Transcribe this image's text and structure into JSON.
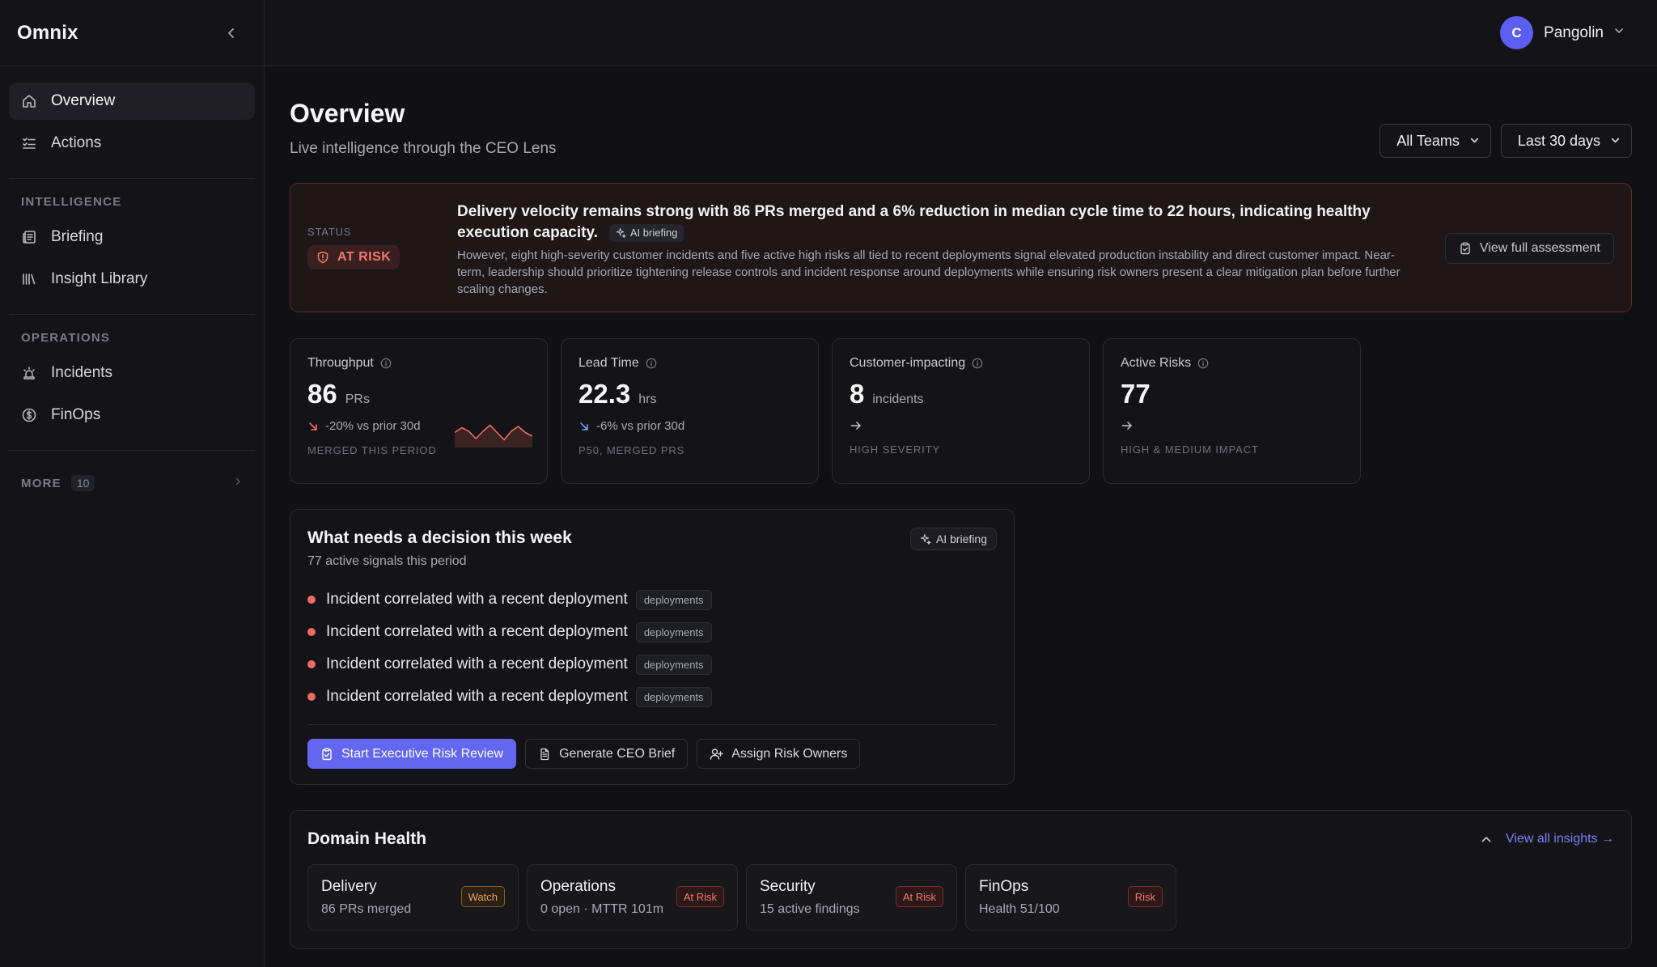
{
  "app": {
    "brand": "Omnix"
  },
  "sidebar": {
    "primary": [
      {
        "label": "Overview",
        "icon": "home-icon",
        "active": true
      },
      {
        "label": "Actions",
        "icon": "list-check-icon",
        "active": false
      }
    ],
    "intelligence_heading": "INTELLIGENCE",
    "intelligence": [
      {
        "label": "Briefing",
        "icon": "newspaper-icon"
      },
      {
        "label": "Insight Library",
        "icon": "library-icon"
      }
    ],
    "operations_heading": "OPERATIONS",
    "operations": [
      {
        "label": "Incidents",
        "icon": "siren-icon"
      },
      {
        "label": "FinOps",
        "icon": "dollar-circle-icon"
      }
    ],
    "more": {
      "label": "MORE",
      "count": "10"
    }
  },
  "user": {
    "initial": "C",
    "name": "Pangolin"
  },
  "header": {
    "title": "Overview",
    "subtitle": "Live intelligence through the CEO Lens",
    "team_filter": "All Teams",
    "range_filter": "Last 30 days"
  },
  "banner": {
    "status_label": "STATUS",
    "status": "AT RISK",
    "headline": "Delivery velocity remains strong with 86 PRs merged and a 6% reduction in median cycle time to 22 hours, indicating healthy execution capacity.",
    "chip": "AI briefing",
    "body": "However, eight high-severity customer incidents and five active high risks all tied to recent deployments signal elevated production instability and direct customer impact. Near-term, leadership should prioritize tightening release controls and incident response around deployments while ensuring risk owners present a clear mitigation plan before further scaling changes.",
    "view_button": "View full assessment"
  },
  "kpis": [
    {
      "label": "Throughput",
      "value": "86",
      "unit": "PRs",
      "delta": "-20% vs prior 30d",
      "foot": "MERGED THIS PERIOD",
      "trend": "down-red"
    },
    {
      "label": "Lead Time",
      "value": "22.3",
      "unit": "hrs",
      "delta": "-6% vs prior 30d",
      "foot": "P50, MERGED PRS",
      "trend": "down-blue"
    },
    {
      "label": "Customer-impacting",
      "value": "8",
      "unit": "incidents",
      "foot": "HIGH SEVERITY"
    },
    {
      "label": "Active Risks",
      "value": "77",
      "unit": "",
      "foot": "HIGH & MEDIUM IMPACT"
    }
  ],
  "decision": {
    "title": "What needs a decision this week",
    "subtitle": "77 active signals this period",
    "chip": "AI briefing",
    "signals": [
      {
        "text": "Incident correlated with a recent deployment",
        "tag": "deployments"
      },
      {
        "text": "Incident correlated with a recent deployment",
        "tag": "deployments"
      },
      {
        "text": "Incident correlated with a recent deployment",
        "tag": "deployments"
      },
      {
        "text": "Incident correlated with a recent deployment",
        "tag": "deployments"
      }
    ],
    "actions": {
      "primary": "Start Executive Risk Review",
      "brief": "Generate CEO Brief",
      "owners": "Assign Risk Owners"
    }
  },
  "domain": {
    "title": "Domain Health",
    "link": "View all insights →",
    "cards": [
      {
        "name": "Delivery",
        "sub": "86 PRs merged",
        "badge": "Watch",
        "tone": "watch"
      },
      {
        "name": "Operations",
        "sub": "0 open · MTTR 101m",
        "badge": "At Risk",
        "tone": "risk"
      },
      {
        "name": "Security",
        "sub": "15 active findings",
        "badge": "At Risk",
        "tone": "risk"
      },
      {
        "name": "FinOps",
        "sub": "Health 51/100",
        "badge": "Risk",
        "tone": "risk"
      }
    ]
  },
  "colors": {
    "accent": "#6366f1",
    "danger": "#ee6b60",
    "warning": "#e9a35a",
    "link": "#7b7ff6"
  },
  "sparkline": [
    0.55,
    0.75,
    0.6,
    0.3,
    0.6,
    0.85,
    0.55,
    0.25,
    0.6,
    0.8,
    0.55,
    0.4
  ]
}
